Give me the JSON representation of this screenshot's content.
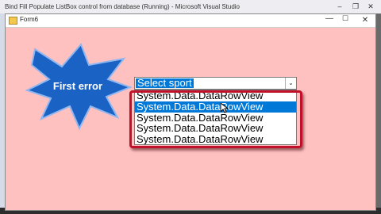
{
  "vs_window": {
    "title": "Bind Fill  Populate ListBox control from database (Running) - Microsoft Visual Studio",
    "minimize_glyph": "–",
    "maximize_glyph": "❐",
    "close_glyph": "✕"
  },
  "form": {
    "title": "Form6",
    "minimize_glyph": "—",
    "maximize_glyph": "☐",
    "close_glyph": "✕"
  },
  "callout": {
    "text": "First error",
    "fill_color": "#1a63c4"
  },
  "combo": {
    "selected_text": "Select sport"
  },
  "listbox": {
    "items": [
      "System.Data.DataRowView",
      "System.Data.DataRowView",
      "System.Data.DataRowView",
      "System.Data.DataRowView",
      "System.Data.DataRowView"
    ],
    "selected_index": 1
  },
  "colors": {
    "form_background": "#ffc0c0",
    "highlight_border": "#c0102a",
    "selection": "#0078d7"
  }
}
